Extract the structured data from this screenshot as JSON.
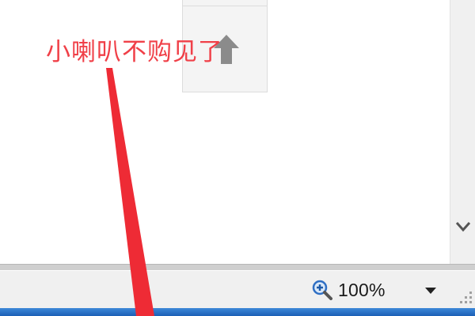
{
  "annotation": {
    "text": "小喇叭不购见了",
    "color": "#f04048"
  },
  "icons": {
    "panel_arrow": "up-arrow-icon",
    "scroll": "chevron-down-icon",
    "zoom": "magnifier-plus-icon",
    "zoom_menu": "dropdown-arrow-icon",
    "grip": "resize-grip-icon"
  },
  "status_bar": {
    "zoom_label": "100%"
  },
  "colors": {
    "taskbar": "#1c5fb6",
    "arrow": "#ee2b35"
  }
}
